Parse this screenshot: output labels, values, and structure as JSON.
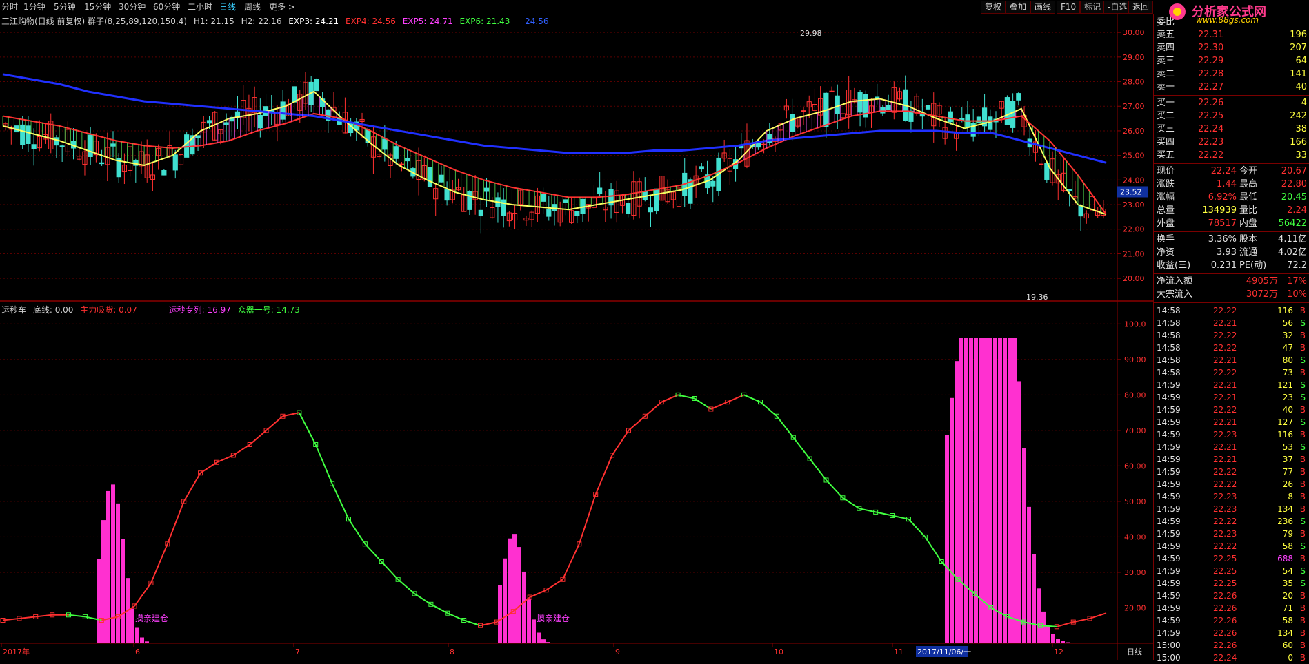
{
  "toolbar": {
    "periods": [
      "分时",
      "1分钟",
      "5分钟",
      "15分钟",
      "30分钟",
      "60分钟",
      "二小时",
      "日线",
      "周线",
      "更多 >"
    ],
    "active_period": "日线",
    "right_buttons": [
      "复权",
      "叠加",
      "画线",
      "F10",
      "标记",
      "-自选",
      "返回"
    ]
  },
  "logo": {
    "main": "分析家公式网",
    "sub": "www.88gs.com"
  },
  "main_header": {
    "title": "三江购物(日线 前复权) 群子(8,25,89,120,150,4)",
    "h1": "H1: 21.15",
    "h2": "H2: 22.16",
    "exp3": "EXP3: 24.21",
    "exp4": "EXP4: 24.56",
    "exp5": "EXP5: 24.71",
    "exp6": "EXP6: 21.43",
    "extra": "24.56"
  },
  "price_axis": [
    "30.00",
    "29.00",
    "28.00",
    "27.00",
    "26.00",
    "25.00",
    "24.00",
    "23.00",
    "22.00",
    "21.00",
    "20.00"
  ],
  "current_price_tag": "23.52",
  "high_label": "29.98",
  "low_label": "19.36",
  "sub_header": {
    "name": "运秒车",
    "bottom_line": "底线: 0.00",
    "main_absorb": "主力吸货: 0.07",
    "series1": "运秒专列: 16.97",
    "series2": "众器一号: 14.73"
  },
  "sub_axis": [
    "100.0",
    "90.00",
    "80.00",
    "70.00",
    "60.00",
    "50.00",
    "40.00",
    "30.00",
    "20.00"
  ],
  "annotations": [
    "摸亲建仓",
    "摸亲建仓"
  ],
  "date_axis": [
    "2017年",
    "6",
    "7",
    "8",
    "9",
    "10",
    "11",
    "12"
  ],
  "date_cursor": "2017/11/06/一",
  "date_period": "日线",
  "order_book": {
    "header": "委比",
    "sells": [
      {
        "label": "卖五",
        "price": "22.31",
        "vol": "196"
      },
      {
        "label": "卖四",
        "price": "22.30",
        "vol": "207"
      },
      {
        "label": "卖三",
        "price": "22.29",
        "vol": "64"
      },
      {
        "label": "卖二",
        "price": "22.28",
        "vol": "141"
      },
      {
        "label": "卖一",
        "price": "22.27",
        "vol": "40"
      }
    ],
    "buys": [
      {
        "label": "买一",
        "price": "22.26",
        "vol": "4"
      },
      {
        "label": "买二",
        "price": "22.25",
        "vol": "242"
      },
      {
        "label": "买三",
        "price": "22.24",
        "vol": "38"
      },
      {
        "label": "买四",
        "price": "22.23",
        "vol": "166"
      },
      {
        "label": "买五",
        "price": "22.22",
        "vol": "33"
      }
    ]
  },
  "quote": [
    {
      "l1": "现价",
      "v1": "22.24",
      "l2": "今开",
      "v2": "20.67",
      "c1": "#ff3030",
      "c2": "#ff3030"
    },
    {
      "l1": "涨跌",
      "v1": "1.44",
      "l2": "最高",
      "v2": "22.80",
      "c1": "#ff3030",
      "c2": "#ff3030"
    },
    {
      "l1": "涨幅",
      "v1": "6.92%",
      "l2": "最低",
      "v2": "20.45",
      "c1": "#ff3030",
      "c2": "#40ff40"
    },
    {
      "l1": "总量",
      "v1": "134939",
      "l2": "量比",
      "v2": "2.24",
      "c1": "#ffff40",
      "c2": "#ff3030"
    },
    {
      "l1": "外盘",
      "v1": "78517",
      "l2": "内盘",
      "v2": "56422",
      "c1": "#ff3030",
      "c2": "#40ff40"
    },
    {
      "l1": "换手",
      "v1": "3.36%",
      "l2": "股本",
      "v2": "4.11亿",
      "c1": "#e0e0e0",
      "c2": "#e0e0e0"
    },
    {
      "l1": "净资",
      "v1": "3.93",
      "l2": "流通",
      "v2": "4.02亿",
      "c1": "#e0e0e0",
      "c2": "#e0e0e0"
    },
    {
      "l1": "收益(三)",
      "v1": "0.231",
      "l2": "PE(动)",
      "v2": "72.2",
      "c1": "#e0e0e0",
      "c2": "#e0e0e0"
    }
  ],
  "flows": [
    {
      "label": "净流入额",
      "value": "4905万",
      "pct": "17%"
    },
    {
      "label": "大宗流入",
      "value": "3072万",
      "pct": "10%"
    }
  ],
  "ticks": [
    {
      "t": "14:58",
      "p": "22.22",
      "v": "116",
      "s": "B"
    },
    {
      "t": "14:58",
      "p": "22.21",
      "v": "56",
      "s": "S"
    },
    {
      "t": "14:58",
      "p": "22.22",
      "v": "32",
      "s": "B"
    },
    {
      "t": "14:58",
      "p": "22.22",
      "v": "47",
      "s": "B"
    },
    {
      "t": "14:58",
      "p": "22.21",
      "v": "80",
      "s": "S"
    },
    {
      "t": "14:58",
      "p": "22.22",
      "v": "73",
      "s": "B"
    },
    {
      "t": "14:59",
      "p": "22.21",
      "v": "121",
      "s": "S"
    },
    {
      "t": "14:59",
      "p": "22.21",
      "v": "23",
      "s": "S"
    },
    {
      "t": "14:59",
      "p": "22.22",
      "v": "40",
      "s": "B"
    },
    {
      "t": "14:59",
      "p": "22.21",
      "v": "127",
      "s": "S"
    },
    {
      "t": "14:59",
      "p": "22.23",
      "v": "116",
      "s": "B"
    },
    {
      "t": "14:59",
      "p": "22.21",
      "v": "53",
      "s": "S"
    },
    {
      "t": "14:59",
      "p": "22.21",
      "v": "37",
      "s": "B"
    },
    {
      "t": "14:59",
      "p": "22.22",
      "v": "77",
      "s": "B"
    },
    {
      "t": "14:59",
      "p": "22.22",
      "v": "26",
      "s": "B"
    },
    {
      "t": "14:59",
      "p": "22.23",
      "v": "8",
      "s": "B"
    },
    {
      "t": "14:59",
      "p": "22.23",
      "v": "134",
      "s": "B"
    },
    {
      "t": "14:59",
      "p": "22.22",
      "v": "236",
      "s": "S"
    },
    {
      "t": "14:59",
      "p": "22.23",
      "v": "79",
      "s": "B"
    },
    {
      "t": "14:59",
      "p": "22.22",
      "v": "58",
      "s": "S"
    },
    {
      "t": "14:59",
      "p": "22.25",
      "v": "688",
      "s": "B"
    },
    {
      "t": "14:59",
      "p": "22.25",
      "v": "54",
      "s": "S"
    },
    {
      "t": "14:59",
      "p": "22.25",
      "v": "35",
      "s": "S"
    },
    {
      "t": "14:59",
      "p": "22.26",
      "v": "20",
      "s": "B"
    },
    {
      "t": "14:59",
      "p": "22.26",
      "v": "71",
      "s": "B"
    },
    {
      "t": "14:59",
      "p": "22.26",
      "v": "58",
      "s": "B"
    },
    {
      "t": "14:59",
      "p": "22.26",
      "v": "134",
      "s": "B"
    },
    {
      "t": "15:00",
      "p": "22.26",
      "v": "60",
      "s": "B"
    },
    {
      "t": "15:00",
      "p": "22.24",
      "v": "0",
      "s": "B"
    }
  ],
  "chart_data": [
    {
      "type": "line",
      "title": "三江购物(日线 前复权)",
      "ylim": [
        19.5,
        30.2
      ],
      "series": [
        {
          "name": "EXP4",
          "values": [
            26.2,
            25.9,
            25.6,
            25.2,
            24.8,
            24.6,
            25.0,
            26.0,
            26.5,
            26.7,
            27.0,
            27.6,
            26.5,
            25.5,
            24.6,
            24.0,
            23.5,
            23.2,
            23.0,
            22.9,
            22.8,
            23.0,
            23.2,
            23.4,
            23.6,
            24.0,
            24.8,
            26.0,
            26.5,
            26.8,
            27.2,
            27.3,
            27.0,
            26.5,
            26.1,
            26.4,
            26.9,
            24.5,
            23.0,
            22.6
          ]
        },
        {
          "name": "EXP5",
          "values": [
            26.6,
            26.4,
            26.2,
            25.9,
            25.6,
            25.4,
            25.3,
            25.4,
            25.6,
            26.0,
            26.3,
            26.7,
            26.5,
            26.0,
            25.4,
            24.9,
            24.4,
            24.0,
            23.7,
            23.5,
            23.3,
            23.3,
            23.4,
            23.6,
            23.8,
            24.2,
            24.7,
            25.3,
            25.8,
            26.2,
            26.6,
            26.8,
            26.8,
            26.6,
            26.4,
            26.4,
            26.6,
            25.6,
            24.2,
            22.6
          ]
        },
        {
          "name": "EXP6",
          "values": [
            28.3,
            28.1,
            27.9,
            27.6,
            27.4,
            27.2,
            27.1,
            27.0,
            26.9,
            26.8,
            26.7,
            26.6,
            26.4,
            26.2,
            26.0,
            25.8,
            25.6,
            25.4,
            25.3,
            25.2,
            25.1,
            25.1,
            25.1,
            25.2,
            25.2,
            25.3,
            25.4,
            25.6,
            25.7,
            25.8,
            25.9,
            26.0,
            26.0,
            26.0,
            25.9,
            25.9,
            25.6,
            25.3,
            25.0,
            24.7
          ]
        }
      ]
    },
    {
      "type": "line",
      "ylim": [
        10,
        102
      ],
      "series": [
        {
          "name": "运秒专列",
          "values": [
            16.5,
            17.0,
            17.5,
            18.0,
            18.0,
            17.5,
            16.5,
            17.5,
            20.5,
            27.0,
            38.0,
            50.0,
            58.0,
            61.0,
            63.0,
            66.0,
            70.0,
            74.0,
            75.0,
            66.0,
            55.0,
            45.0,
            38.0,
            33.0,
            28.0,
            24.0,
            21.0,
            18.5,
            16.5,
            15.0,
            16.0,
            19.0,
            23.0,
            25.0,
            28.0,
            38.0,
            52.0,
            63.0,
            70.0,
            74.0,
            78.0,
            80.0,
            79.0,
            76.0,
            78.0,
            80.0,
            78.0,
            74.0,
            68.0,
            62.0,
            56.0,
            51.0,
            48.0,
            47.0,
            46.0,
            45.0,
            40.0,
            33.0,
            28.0,
            24.0,
            20.0,
            17.5,
            16.0,
            15.0,
            14.7,
            16.0,
            17.0,
            18.5
          ]
        }
      ]
    }
  ]
}
